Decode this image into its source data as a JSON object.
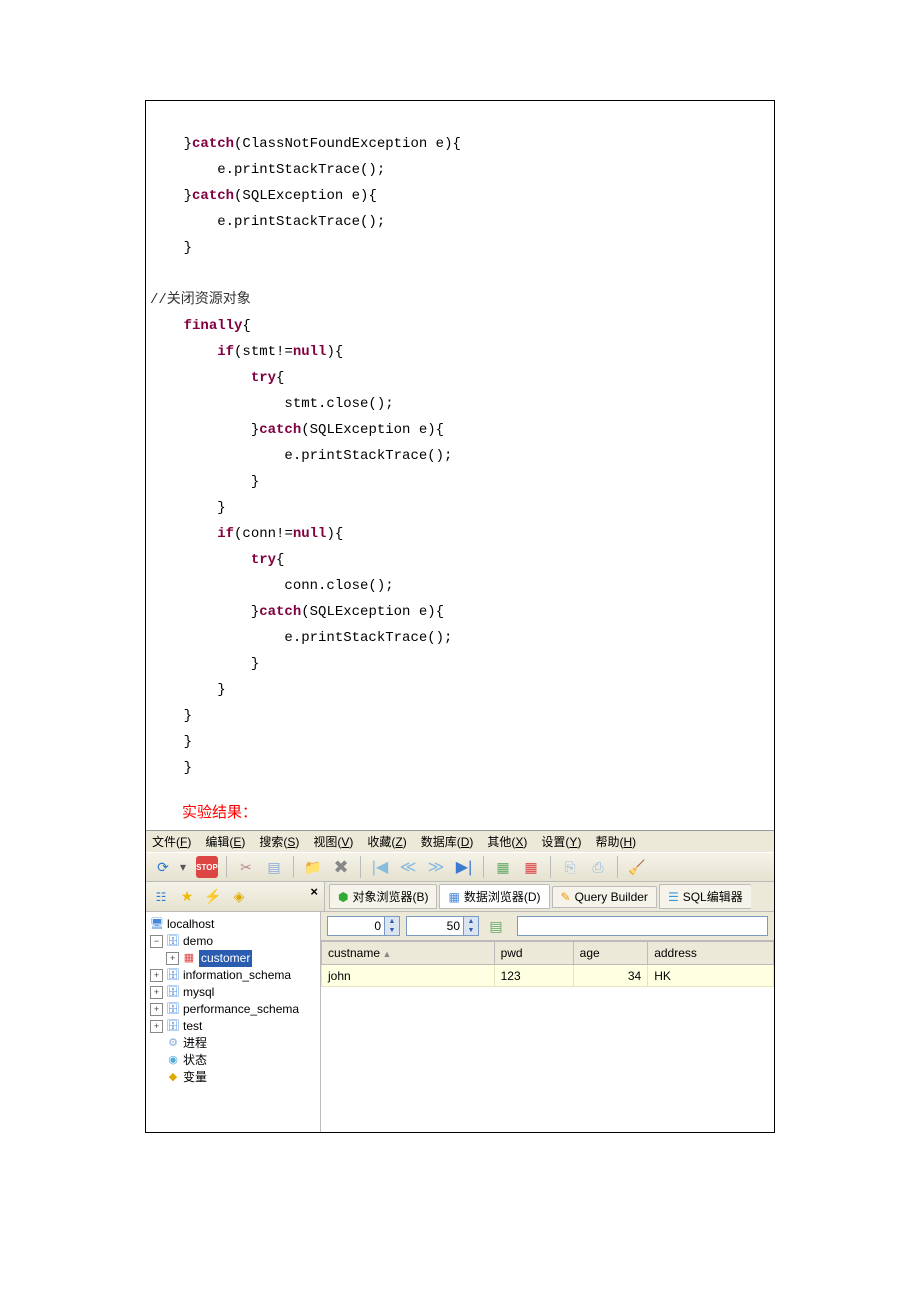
{
  "code": {
    "l1": "    }catch(ClassNotFoundException e){",
    "l2": "        e.printStackTrace();",
    "l3": "    }catch(SQLException e){",
    "l4": "        e.printStackTrace();",
    "l5": "    }",
    "l6": "",
    "l7": "//关闭资源对象",
    "l8": "    finally{",
    "l9": "        if(stmt!=null){",
    "l10": "            try{",
    "l11": "                stmt.close();",
    "l12": "            }catch(SQLException e){",
    "l13": "                e.printStackTrace();",
    "l14": "            }",
    "l15": "        }",
    "l16": "        if(conn!=null){",
    "l17": "            try{",
    "l18": "                conn.close();",
    "l19": "            }catch(SQLException e){",
    "l20": "                e.printStackTrace();",
    "l21": "            }",
    "l22": "        }",
    "l23": "    }",
    "l24": "    }",
    "l25": "    }"
  },
  "result_label": "实验结果：",
  "menus": [
    "文件(F)",
    "编辑(E)",
    "搜索(S)",
    "视图(V)",
    "收藏(Z)",
    "数据库(D)",
    "其他(X)",
    "设置(Y)",
    "帮助(H)"
  ],
  "tabs": {
    "obj": "对象浏览器(B)",
    "data": "数据浏览器(D)",
    "qb": "Query Builder",
    "sql": "SQL编辑器"
  },
  "spin1": "0",
  "spin2": "50",
  "tree": {
    "root": "localhost",
    "n1": "demo",
    "n1a": "customer",
    "n2": "information_schema",
    "n3": "mysql",
    "n4": "performance_schema",
    "n5": "test",
    "p1": "进程",
    "p2": "状态",
    "p3": "变量"
  },
  "cols": {
    "c1": "custname",
    "c2": "pwd",
    "c3": "age",
    "c4": "address"
  },
  "row": {
    "c1": "john",
    "c2": "123",
    "c3": "34",
    "c4": "HK"
  }
}
